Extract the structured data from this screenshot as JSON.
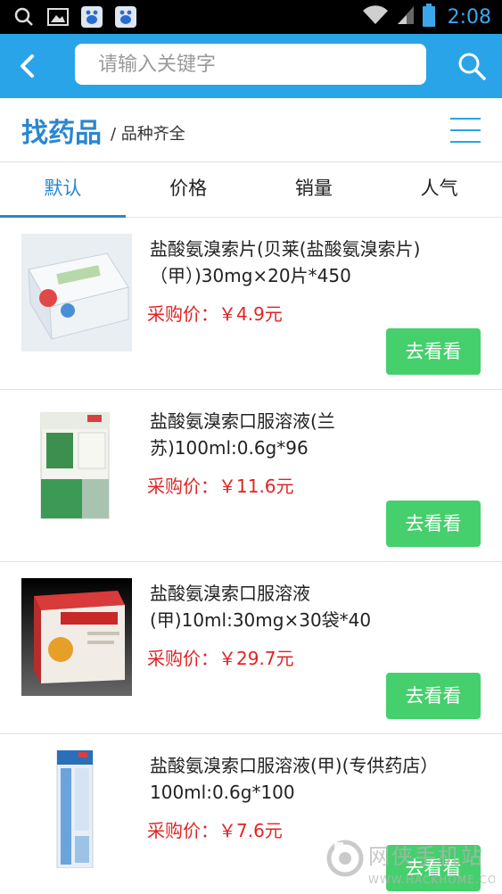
{
  "status_bar": {
    "time": "2:08",
    "icons_left": [
      "search-icon",
      "image-icon",
      "baidu-icon",
      "baidu-icon"
    ],
    "icons_right": [
      "wifi-icon",
      "signal-icon",
      "battery-icon"
    ]
  },
  "header": {
    "search_placeholder": "请输入关键字"
  },
  "section": {
    "title": "找药品",
    "subtitle": "/ 品种齐全"
  },
  "tabs": [
    {
      "label": "默认",
      "active": true
    },
    {
      "label": "价格",
      "active": false
    },
    {
      "label": "销量",
      "active": false
    },
    {
      "label": "人气",
      "active": false
    }
  ],
  "products": [
    {
      "name": "盐酸氨溴索片(贝莱(盐酸氨溴索片)（甲）)30mg×20片*450",
      "price": "采购价：￥4.9元",
      "action": "去看看"
    },
    {
      "name": "盐酸氨溴索口服溶液(兰苏)100ml:0.6g*96",
      "price": "采购价：￥11.6元",
      "action": "去看看"
    },
    {
      "name": "盐酸氨溴索口服溶液(甲)10ml:30mg×30袋*40",
      "price": "采购价：￥29.7元",
      "action": "去看看"
    },
    {
      "name": "盐酸氨溴索口服溶液(甲)(专供药店）100ml:0.6g*100",
      "price": "采购价：￥7.6元",
      "action": "去看看"
    }
  ],
  "watermark": {
    "text": "网侠手机站",
    "url": "WWW.HACKHOME.COM"
  },
  "colors": {
    "accent": "#2aa4e8",
    "title_blue": "#2a86d0",
    "price_red": "#e02424",
    "button_green": "#46cf6d"
  }
}
